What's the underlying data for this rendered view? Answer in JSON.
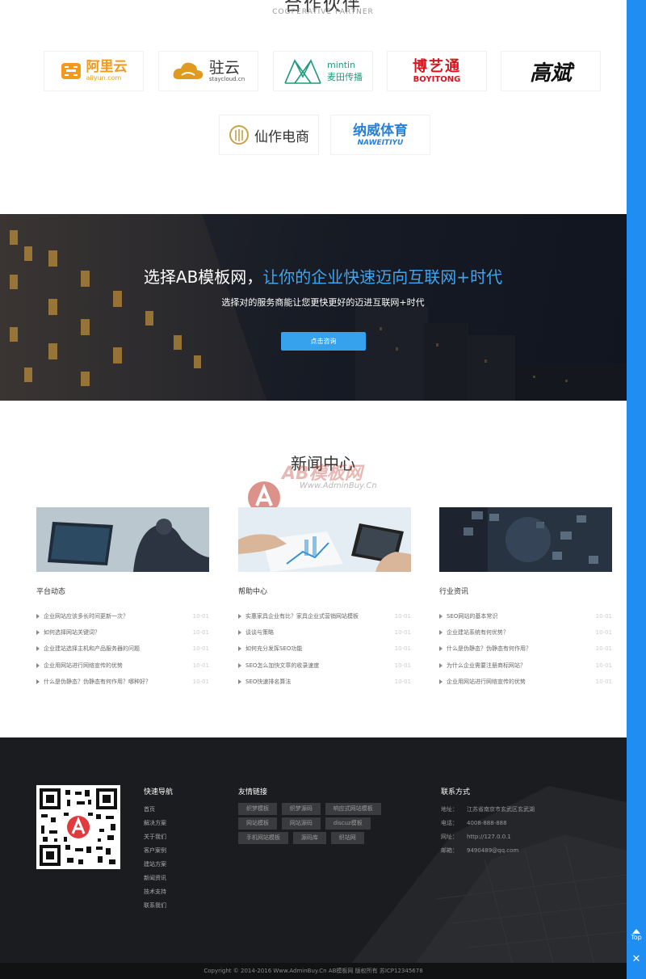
{
  "partners": {
    "title": "合作伙伴",
    "subtitle": "COOPERATIVE PARTNER",
    "logos": [
      {
        "name": "阿里云",
        "sub": "aliyun.com"
      },
      {
        "name": "驻云",
        "sub": "staycloud.cn"
      },
      {
        "name": "mintin",
        "sub": "麦田传播"
      },
      {
        "name": "博艺通",
        "sub": "BOYITONG"
      },
      {
        "name": "高斌"
      },
      {
        "name": "仙作电商"
      },
      {
        "name": "纳威体育",
        "sub": "NAWEITIYU"
      }
    ]
  },
  "banner": {
    "title_main": "选择AB模板网，",
    "title_accent": "让你的企业快速迈向互联网+时代",
    "subtitle": "选择对的服务商能让您更快更好的迈进互联网+时代",
    "button": "点击咨询"
  },
  "news": {
    "title": "新闻中心",
    "watermark": {
      "big": "AB模板网",
      "small": "Www.AdminBuy.Cn"
    },
    "columns": [
      {
        "title": "平台动态",
        "items": [
          {
            "text": "企业网站应该多长时间更新一次？",
            "date": "10-01"
          },
          {
            "text": "如何选择网站关键词？",
            "date": "10-01"
          },
          {
            "text": "企业建站选择主机和产品服务器的问题",
            "date": "10-01"
          },
          {
            "text": "企业用网站进行网络宣传的优势",
            "date": "10-01"
          },
          {
            "text": "什么是伪静态？伪静态有何作用？哪种好？",
            "date": "10-01"
          }
        ]
      },
      {
        "title": "帮助中心",
        "items": [
          {
            "text": "实惠家具企业有比？家具企业式营销网站模板",
            "date": "10-01"
          },
          {
            "text": "谈谈与策略",
            "date": "10-01"
          },
          {
            "text": "如何充分发挥SEO功能",
            "date": "10-01"
          },
          {
            "text": "SEO怎么加快文章的收录速度",
            "date": "10-01"
          },
          {
            "text": "SEO快速排名算法",
            "date": "10-01"
          }
        ]
      },
      {
        "title": "行业资讯",
        "items": [
          {
            "text": "SEO网站的基本常识",
            "date": "10-01"
          },
          {
            "text": "企业建站系统有何优势？",
            "date": "10-01"
          },
          {
            "text": "什么是伪静态？伪静态有何作用？",
            "date": "10-01"
          },
          {
            "text": "为什么企业需要注册商标网站？",
            "date": "10-01"
          },
          {
            "text": "企业用网站进行网络宣传的优势",
            "date": "10-01"
          }
        ]
      }
    ]
  },
  "footer": {
    "nav_title": "快速导航",
    "nav": [
      "首页",
      "解决方案",
      "关于我们",
      "客户案例",
      "建站方案",
      "新闻资讯",
      "技术支持",
      "联系我们"
    ],
    "links_title": "友情链接",
    "links": [
      "织梦模板",
      "织梦源码",
      "响应式网站模板",
      "网站模板",
      "网站源码",
      "discuz模板",
      "手机网站模板",
      "源码库",
      "织站网"
    ],
    "contact_title": "联系方式",
    "contact": [
      {
        "label": "地址：",
        "value": "江苏省南京市玄武区玄武湖"
      },
      {
        "label": "电话：",
        "value": "4008-888-888"
      },
      {
        "label": "网址：",
        "value": "http://127.0.0.1"
      },
      {
        "label": "邮箱：",
        "value": "9490489@qq.com"
      }
    ],
    "copyright": "Copyright © 2014-2016 Www.AdminBuy.Cn AB模板网 版权所有 苏ICP12345678"
  },
  "sidebar": {
    "top_label": "Top",
    "close_label": "✕"
  }
}
